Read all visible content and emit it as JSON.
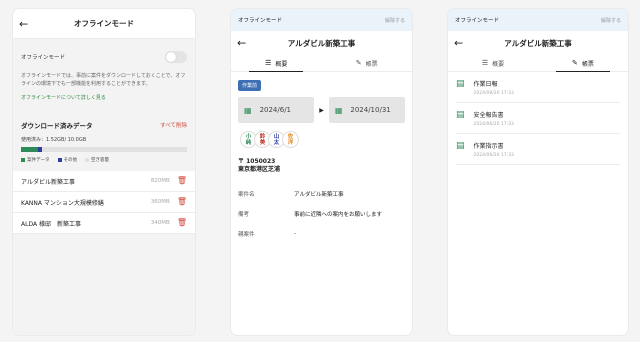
{
  "panel1": {
    "title": "オフラインモード",
    "toggle_label": "オフラインモード",
    "description": "オフラインモードでは、事前に案件をダウンロードしておくことで、オフラインの環境下でも一部機能を利用することができます。",
    "learn_more": "オフラインモードについて詳しく見る",
    "downloaded_title": "ダウンロード済みデータ",
    "delete_all": "すべて削除",
    "usage": "使用済み：1.52GB/ 10.0GB",
    "usage_bar": {
      "project_fraction": 0.1,
      "other_fraction": 0.025
    },
    "legend": [
      "案件データ",
      "その他",
      "空き容量"
    ],
    "items": [
      {
        "name": "アルダビル新築工事",
        "size": "820MB"
      },
      {
        "name": "KANNA マンション大規模修繕",
        "size": "360MB"
      },
      {
        "name": "ALDA 様邸　新築工事",
        "size": "340MB"
      }
    ]
  },
  "panel2": {
    "status_label": "オフラインモード",
    "status_action": "解除する",
    "title": "アルダビル新築工事",
    "tabs": [
      "概要",
      "帳票"
    ],
    "badge": "作業前",
    "start_date": "2024/6/1",
    "end_date": "2024/10/31",
    "avatars": [
      {
        "top": "小",
        "bottom": "純",
        "color": "#2e8b57"
      },
      {
        "top": "鈴",
        "bottom": "美",
        "color": "#c0392b"
      },
      {
        "top": "山",
        "bottom": "太",
        "color": "#2c3e9e"
      },
      {
        "top": "佐",
        "bottom": "洋",
        "color": "#e08a1e"
      }
    ],
    "postal": "〒 1050023",
    "address": "東京都港区芝浦",
    "fields": [
      {
        "key": "案件名",
        "value": "アルダビル新築工事"
      },
      {
        "key": "備考",
        "value": "事前に近隣への案内をお願いします"
      },
      {
        "key": "親案件",
        "value": "-"
      }
    ]
  },
  "panel3": {
    "status_label": "オフラインモード",
    "status_action": "解除する",
    "title": "アルダビル新築工事",
    "tabs": [
      "概要",
      "帳票"
    ],
    "docs": [
      {
        "name": "作業日報",
        "date": "2024/08/20 17:33"
      },
      {
        "name": "安全報告書",
        "date": "2024/06/20 17:33"
      },
      {
        "name": "作業指示書",
        "date": "2024/06/20 17:33"
      }
    ]
  },
  "colors": {
    "accent_green": "#2e8b57",
    "danger": "#d0493d",
    "badge_blue": "#3d6fb5"
  }
}
